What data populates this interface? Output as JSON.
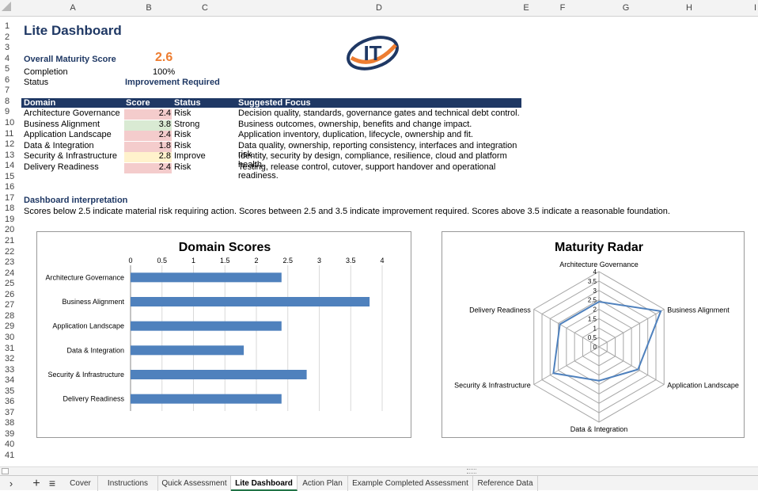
{
  "columns": [
    "A",
    "B",
    "C",
    "D",
    "E",
    "F",
    "G",
    "H",
    "I"
  ],
  "rows": [
    "1",
    "2",
    "3",
    "4",
    "5",
    "6",
    "7",
    "8",
    "9",
    "10",
    "11",
    "12",
    "13",
    "14",
    "15",
    "16",
    "17",
    "18",
    "19",
    "20",
    "21",
    "22",
    "23",
    "24",
    "25",
    "26",
    "27",
    "28",
    "29",
    "30",
    "31",
    "32",
    "33",
    "34",
    "35",
    "36",
    "37",
    "38",
    "39",
    "40",
    "41"
  ],
  "sheet": {
    "title": "Lite Dashboard",
    "overall_label": "Overall Maturity Score",
    "overall_value": "2.6",
    "completion_label": "Completion",
    "completion_value": "100%",
    "status_label": "Status",
    "status_value": "Improvement Required",
    "logo_text": "IT",
    "table_headers": [
      "Domain",
      "Score",
      "Status",
      "Suggested Focus"
    ],
    "table_rows": [
      {
        "domain": "Architecture Governance",
        "score": "2.4",
        "status": "Risk",
        "focus": "Decision quality, standards, governance gates and technical debt control.",
        "color": "#f4cccc"
      },
      {
        "domain": "Business Alignment",
        "score": "3.8",
        "status": "Strong",
        "focus": "Business outcomes, ownership, benefits and change impact.",
        "color": "#d9ead3"
      },
      {
        "domain": "Application Landscape",
        "score": "2.4",
        "status": "Risk",
        "focus": "Application inventory, duplication, lifecycle, ownership and fit.",
        "color": "#f4cccc"
      },
      {
        "domain": "Data & Integration",
        "score": "1.8",
        "status": "Risk",
        "focus": "Data quality, ownership, reporting consistency, interfaces and integration risk.",
        "color": "#f4cccc"
      },
      {
        "domain": "Security & Infrastructure",
        "score": "2.8",
        "status": "Improve",
        "focus": "Identity, security by design, compliance, resilience, cloud and platform health.",
        "color": "#fff2cc"
      },
      {
        "domain": "Delivery Readiness",
        "score": "2.4",
        "status": "Risk",
        "focus": "Testing, release control, cutover, support handover and operational readiness.",
        "color": "#f4cccc"
      }
    ],
    "interp_title": "Dashboard interpretation",
    "interp_text": "Scores below 2.5 indicate material risk requiring action. Scores between 2.5 and 3.5 indicate improvement required. Scores above 3.5 indicate a reasonable foundation."
  },
  "chart_data": [
    {
      "type": "bar",
      "title": "Domain Scores",
      "categories": [
        "Architecture Governance",
        "Business Alignment",
        "Application Landscape",
        "Data & Integration",
        "Security & Infrastructure",
        "Delivery Readiness"
      ],
      "values": [
        2.4,
        3.8,
        2.4,
        1.8,
        2.8,
        2.4
      ],
      "ticks": [
        "0",
        "0.5",
        "1",
        "1.5",
        "2",
        "2.5",
        "3",
        "3.5",
        "4"
      ],
      "xlim": [
        0,
        4
      ],
      "orientation": "horizontal",
      "color": "#4f81bd",
      "grid": true
    },
    {
      "type": "radar",
      "title": "Maturity Radar",
      "categories": [
        "Architecture Governance",
        "Business Alignment",
        "Application Landscape",
        "Data & Integration",
        "Security & Infrastructure",
        "Delivery Readiness"
      ],
      "values": [
        2.4,
        3.8,
        2.4,
        1.8,
        2.8,
        2.4
      ],
      "ticks": [
        "0",
        "0.5",
        "1",
        "1.5",
        "2",
        "2.5",
        "3",
        "3.5",
        "4"
      ],
      "rlim": [
        0,
        4
      ],
      "color": "#4f81bd"
    }
  ],
  "tabs": [
    "Cover",
    "Instructions",
    "Quick Assessment",
    "Lite Dashboard",
    "Action Plan",
    "Example Completed Assessment",
    "Reference Data"
  ],
  "active_tab": "Lite Dashboard",
  "colors": {
    "header": "#1f3864",
    "accent": "#ed7d31",
    "series": "#4f81bd",
    "tab_active": "#217346"
  }
}
